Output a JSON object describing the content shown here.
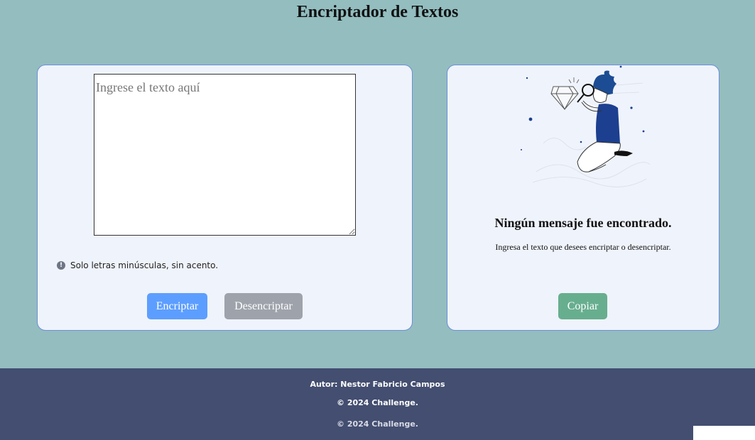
{
  "header": {
    "title": "Encriptador de Textos"
  },
  "input_panel": {
    "textarea_placeholder": "Ingrese el texto aquí",
    "textarea_value": "",
    "hint_icon": "info-circle-icon",
    "hint_text": "Solo letras minúsculas, sin acento.",
    "encrypt_label": "Encriptar",
    "decrypt_label": "Desencriptar"
  },
  "output_panel": {
    "illustration": "person-with-magnifier-illustration",
    "title": "Ningún mensaje fue encontrado.",
    "subtitle": "Ingresa el texto que desees encriptar o desencriptar.",
    "copy_label": "Copiar"
  },
  "footer": {
    "author": "Autor: Nestor Fabricio Campos",
    "copyright": "© 2024 Challenge.",
    "ghost_copyright": "© 2024 Challenge."
  },
  "colors": {
    "background": "#93bdbf",
    "card": "#eff3fb",
    "card_border": "#6b8fd6",
    "encrypt_button": "#5c9eff",
    "decrypt_button": "#9ea3ab",
    "copy_button": "#67ae8f",
    "footer": "#434e70"
  }
}
